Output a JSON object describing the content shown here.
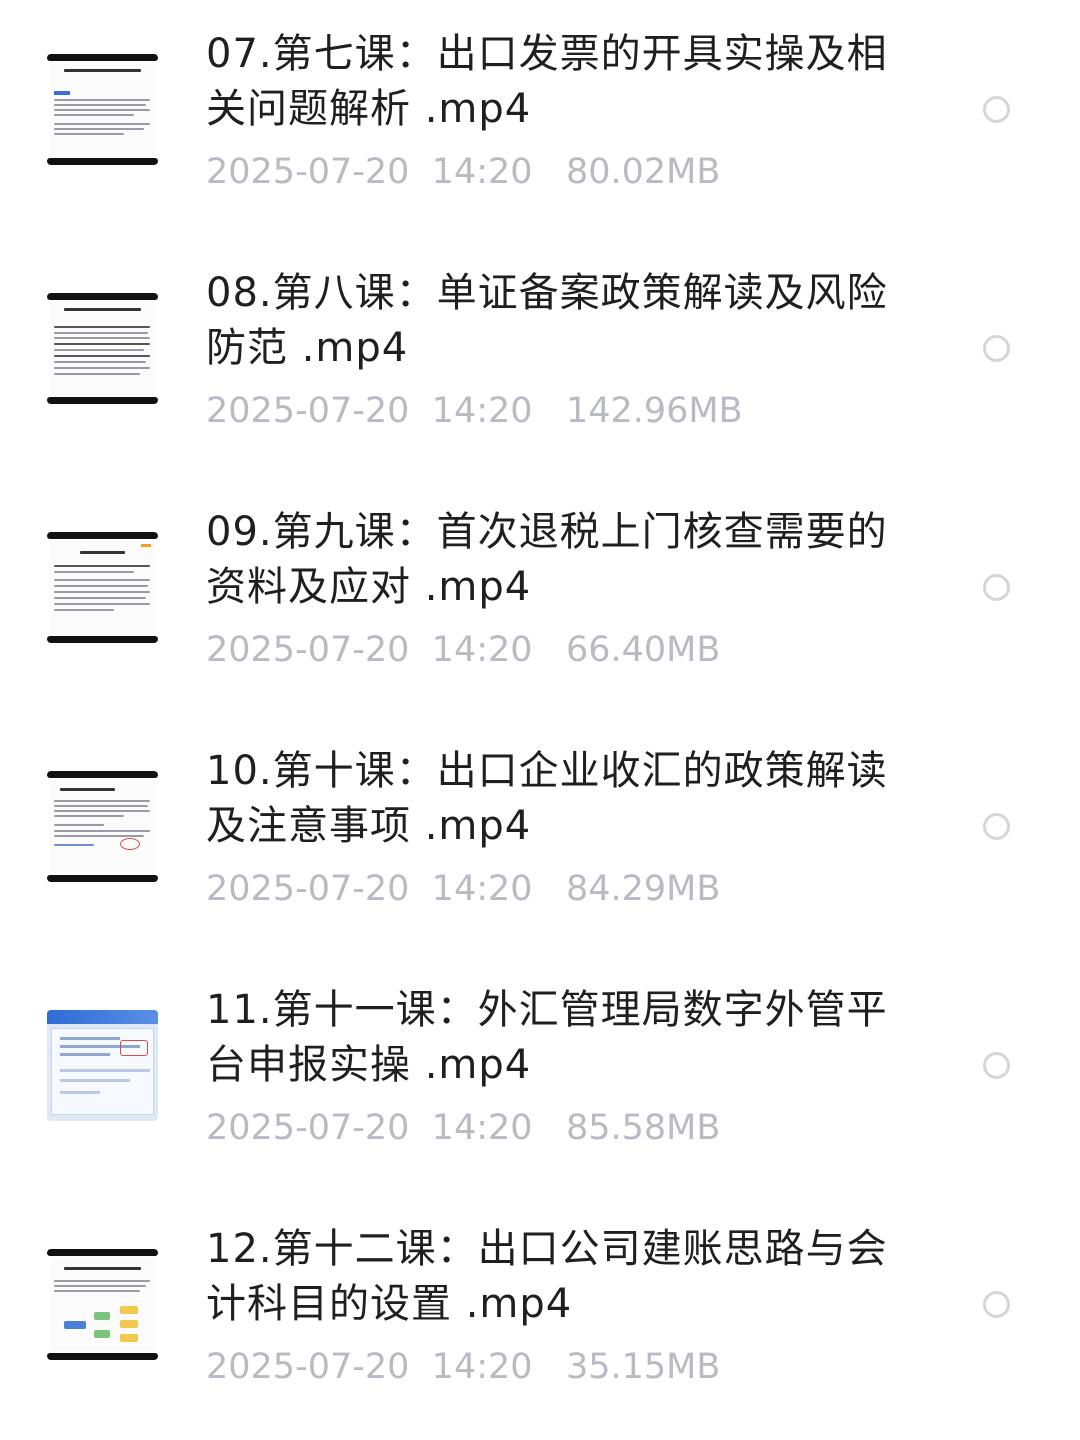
{
  "files": [
    {
      "title": "07.第七课：出口发票的开具实操及相关问题解析 .mp4",
      "date": "2025-07-20",
      "time": "14:20",
      "size": "80.02MB",
      "thumb": "document"
    },
    {
      "title": "08.第八课：单证备案政策解读及风险防范 .mp4",
      "date": "2025-07-20",
      "time": "14:20",
      "size": "142.96MB",
      "thumb": "document"
    },
    {
      "title": "09.第九课：首次退税上门核查需要的资料及应对 .mp4",
      "date": "2025-07-20",
      "time": "14:20",
      "size": "66.40MB",
      "thumb": "document"
    },
    {
      "title": "10.第十课：出口企业收汇的政策解读及注意事项 .mp4",
      "date": "2025-07-20",
      "time": "14:20",
      "size": "84.29MB",
      "thumb": "document"
    },
    {
      "title": "11.第十一课：外汇管理局数字外管平台申报实操 .mp4",
      "date": "2025-07-20",
      "time": "14:20",
      "size": "85.58MB",
      "thumb": "screenshot"
    },
    {
      "title": "12.第十二课：出口公司建账思路与会计科目的设置 .mp4",
      "date": "2025-07-20",
      "time": "14:20",
      "size": "35.15MB",
      "thumb": "diagram"
    }
  ],
  "colors": {
    "title": "#1f1f1f",
    "meta": "#b9bac3",
    "radio_border": "#d6d6d6"
  }
}
